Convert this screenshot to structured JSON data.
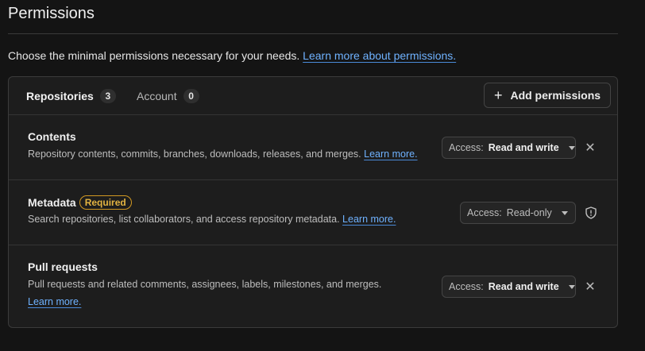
{
  "page": {
    "title": "Permissions",
    "intro_text": "Choose the minimal permissions necessary for your needs.",
    "intro_link": "Learn more about permissions."
  },
  "tabs": [
    {
      "label": "Repositories",
      "count": "3",
      "active": true
    },
    {
      "label": "Account",
      "count": "0",
      "active": false
    }
  ],
  "add_button": {
    "label": "Add permissions",
    "icon": "plus-icon"
  },
  "permissions": [
    {
      "title": "Contents",
      "description": "Repository contents, commits, branches, downloads, releases, and merges.",
      "link": "Learn more.",
      "access_prefix": "Access:",
      "access_value": "Read and write",
      "action_icon": "x-icon"
    },
    {
      "title": "Metadata",
      "badge": "Required",
      "description": "Search repositories, list collaborators, and access repository metadata.",
      "link": "Learn more.",
      "access_prefix": "Access:",
      "access_value": "Read-only",
      "action_icon": "shield-icon"
    },
    {
      "title": "Pull requests",
      "description": "Pull requests and related comments, assignees, labels, milestones, and merges.",
      "link": "Learn more.",
      "access_prefix": "Access:",
      "access_value": "Read and write",
      "action_icon": "x-icon"
    }
  ],
  "colors": {
    "background": "#141414",
    "panel": "#1d1d1d",
    "link": "#6fb2ff",
    "required_badge": "#d29922"
  }
}
